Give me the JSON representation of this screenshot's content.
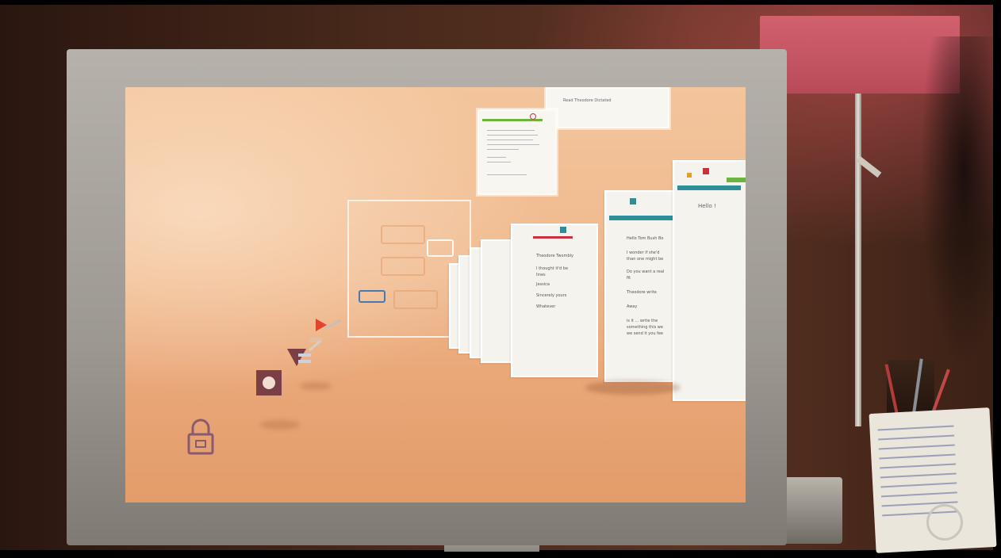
{
  "screen": {
    "top_window": {
      "title": "Read Theodore Dictated"
    },
    "email_window": {
      "header": "",
      "lines": []
    },
    "stack_window_front": {
      "header": "",
      "lines": [
        "Hello !",
        "",
        "",
        "",
        ""
      ]
    },
    "stack_window_second": {
      "header": "",
      "lines": [
        "Hello Tom Bush Bo",
        "I wonder if she'd",
        "than one might be",
        "Do you want a real",
        "fit",
        "Theodore write",
        "Away",
        "is it ... write the",
        "something this we",
        "we send it you fee"
      ]
    },
    "stack_window_third": {
      "header": "",
      "lines": [
        "Theodore Twombly",
        "I thought it'd be",
        "lines",
        "Jessica",
        "Sincerely yours",
        "Whatever"
      ]
    },
    "colors": {
      "screen_top": "#f3c59c",
      "screen_bottom": "#e39c6a",
      "accent_green": "#6cb43c",
      "accent_teal": "#2e8f98",
      "accent_red": "#c8323c",
      "accent_navy": "#2a3a6a",
      "icon_plum": "#8a5a6e"
    },
    "icons": [
      "lock-icon",
      "stop-icon",
      "navigation-cursor-icon"
    ]
  }
}
